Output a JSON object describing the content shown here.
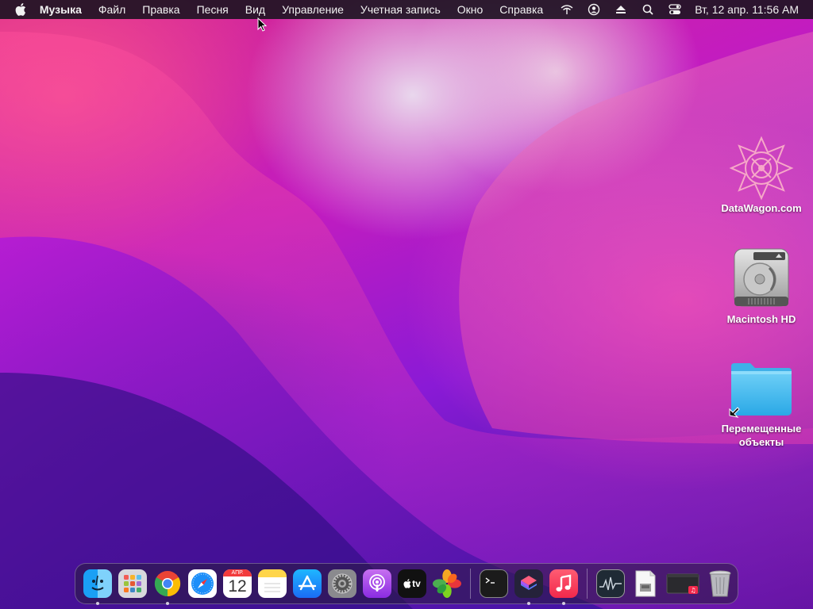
{
  "menubar": {
    "app_name": "Музыка",
    "menus": [
      "Файл",
      "Правка",
      "Песня",
      "Вид",
      "Управление",
      "Учетная запись",
      "Окно",
      "Справка"
    ],
    "clock": "Вт, 12 апр.  11:56 AM",
    "status_icons": [
      "wifi-icon",
      "user-account-icon",
      "eject-icon",
      "search-icon",
      "control-center-icon"
    ]
  },
  "desktop_icons": [
    {
      "label": "DataWagon.com",
      "icon": "datawagon-logo-icon"
    },
    {
      "label": "Macintosh HD",
      "icon": "hard-drive-icon"
    },
    {
      "label": "Перемещенные объекты",
      "icon": "folder-alias-icon"
    }
  ],
  "dock": {
    "calendar_month": "АПР.",
    "calendar_day": "12",
    "tv_label": "tv",
    "items": [
      {
        "name": "finder",
        "running": true
      },
      {
        "name": "launchpad",
        "running": false
      },
      {
        "name": "chrome",
        "running": true
      },
      {
        "name": "safari",
        "running": false
      },
      {
        "name": "calendar",
        "running": false
      },
      {
        "name": "notes",
        "running": false
      },
      {
        "name": "app-store",
        "running": false
      },
      {
        "name": "system-preferences",
        "running": false
      },
      {
        "name": "podcasts",
        "running": false
      },
      {
        "name": "apple-tv",
        "running": false
      },
      {
        "name": "photos-clover",
        "running": false
      },
      {
        "name": "terminal",
        "running": false
      },
      {
        "name": "shortcuts",
        "running": true
      },
      {
        "name": "music",
        "running": true
      },
      {
        "name": "activity-monitor",
        "running": false
      },
      {
        "name": "preview-document",
        "running": false
      },
      {
        "name": "music-window",
        "running": false
      },
      {
        "name": "trash",
        "running": false
      }
    ]
  },
  "colors": {
    "menubar_bg": "#1e1423",
    "wallpaper_primary": "#c31cbf",
    "wallpaper_deep": "#2b0f7a"
  }
}
